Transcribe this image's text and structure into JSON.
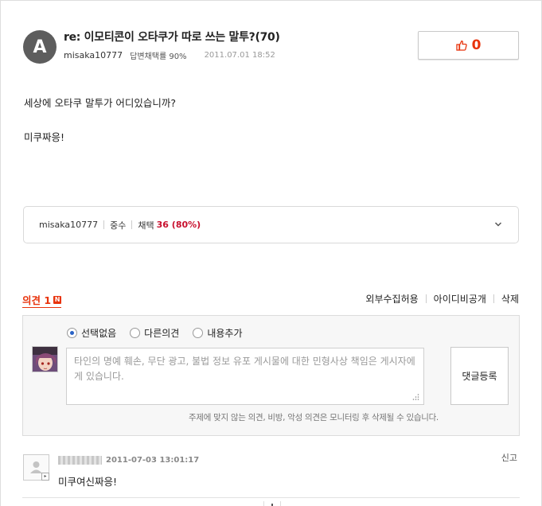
{
  "question": {
    "avatar_letter": "A",
    "title": "re: 이모티콘이 오타쿠가 따로 쓰는 말투?(70)",
    "user": "misaka10777",
    "adoption_rate": "답변채택률 90%",
    "date": "2011.07.01 18:52",
    "like_count": "0",
    "body_line1": "세상에 오타쿠 말투가 어디있습니까?",
    "body_line2": "미쿠짜응!"
  },
  "profile": {
    "name": "misaka10777",
    "level": "중수",
    "selection_label": "채택",
    "selection_value": "36 (80%)"
  },
  "opinions": {
    "title": "의견 1",
    "new_badge": "N",
    "actions": [
      "외부수집허용",
      "아이디비공개",
      "삭제"
    ]
  },
  "form": {
    "radios": [
      {
        "label": "선택없음",
        "checked": true
      },
      {
        "label": "다른의견",
        "checked": false
      },
      {
        "label": "내용추가",
        "checked": false
      }
    ],
    "placeholder": "타인의 명예 훼손, 무단 광고, 불법 정보 유포 게시물에 대한 민형사상 책임은 게시자에게 있습니다.",
    "submit_label": "댓글등록",
    "note": "주제에 맞지 않는 의견, 비방, 악성 의견은 모니터링 후 삭제될 수 있습니다."
  },
  "comment": {
    "date": "2011-07-03 13:01:17",
    "report_label": "신고",
    "text": "미쿠여신짜응!"
  },
  "colors": {
    "accent": "#e8330c",
    "selection_red": "#c8102e",
    "radio_blue": "#2a63c6"
  }
}
